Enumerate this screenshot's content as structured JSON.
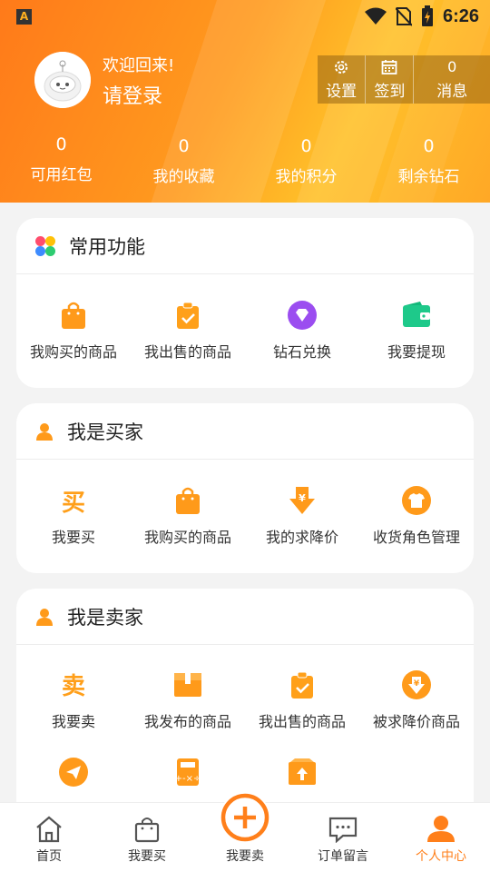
{
  "status_bar": {
    "time": "6:26",
    "app_icon_letter": "A"
  },
  "profile": {
    "welcome": "欢迎回来!",
    "login": "请登录"
  },
  "actions": [
    {
      "label": "设置",
      "icon": "gear-icon"
    },
    {
      "label": "签到",
      "icon": "calendar-icon"
    },
    {
      "count": "0",
      "label": "消息"
    }
  ],
  "stats": [
    {
      "value": "0",
      "label": "可用红包"
    },
    {
      "value": "0",
      "label": "我的收藏"
    },
    {
      "value": "0",
      "label": "我的积分"
    },
    {
      "value": "0",
      "label": "剩余钻石"
    }
  ],
  "common": {
    "title": "常用功能",
    "items": [
      {
        "label": "我购买的商品",
        "icon": "shopping-bag-icon"
      },
      {
        "label": "我出售的商品",
        "icon": "sold-bag-icon"
      },
      {
        "label": "钻石兑换",
        "icon": "diamond-icon"
      },
      {
        "label": "我要提现",
        "icon": "wallet-icon"
      }
    ]
  },
  "buyer": {
    "title": "我是买家",
    "items": [
      {
        "label": "我要买",
        "icon": "buy-char-icon",
        "glyph": "买"
      },
      {
        "label": "我购买的商品",
        "icon": "shopping-bag-icon"
      },
      {
        "label": "我的求降价",
        "icon": "price-down-icon"
      },
      {
        "label": "收货角色管理",
        "icon": "shirt-icon"
      }
    ]
  },
  "seller": {
    "title": "我是卖家",
    "items": [
      {
        "label": "我要卖",
        "icon": "sell-char-icon",
        "glyph": "卖"
      },
      {
        "label": "我发布的商品",
        "icon": "box-icon"
      },
      {
        "label": "我出售的商品",
        "icon": "sold-bag-icon"
      },
      {
        "label": "被求降价商品",
        "icon": "price-down-circle-icon"
      },
      {
        "label": "",
        "icon": "paper-plane-icon"
      },
      {
        "label": "",
        "icon": "calculator-icon"
      },
      {
        "label": "",
        "icon": "upload-box-icon"
      }
    ]
  },
  "tabs": [
    {
      "label": "首页",
      "icon": "home-icon"
    },
    {
      "label": "我要买",
      "icon": "bag-icon"
    },
    {
      "label": "我要卖",
      "icon": "plus-circle-icon"
    },
    {
      "label": "订单留言",
      "icon": "message-icon"
    },
    {
      "label": "个人中心",
      "icon": "user-icon",
      "active": true
    }
  ],
  "colors": {
    "accent": "#ff8a1a",
    "accent_light": "#ffb02a",
    "diamond": "#9b4df0",
    "wallet": "#1ec98a"
  }
}
